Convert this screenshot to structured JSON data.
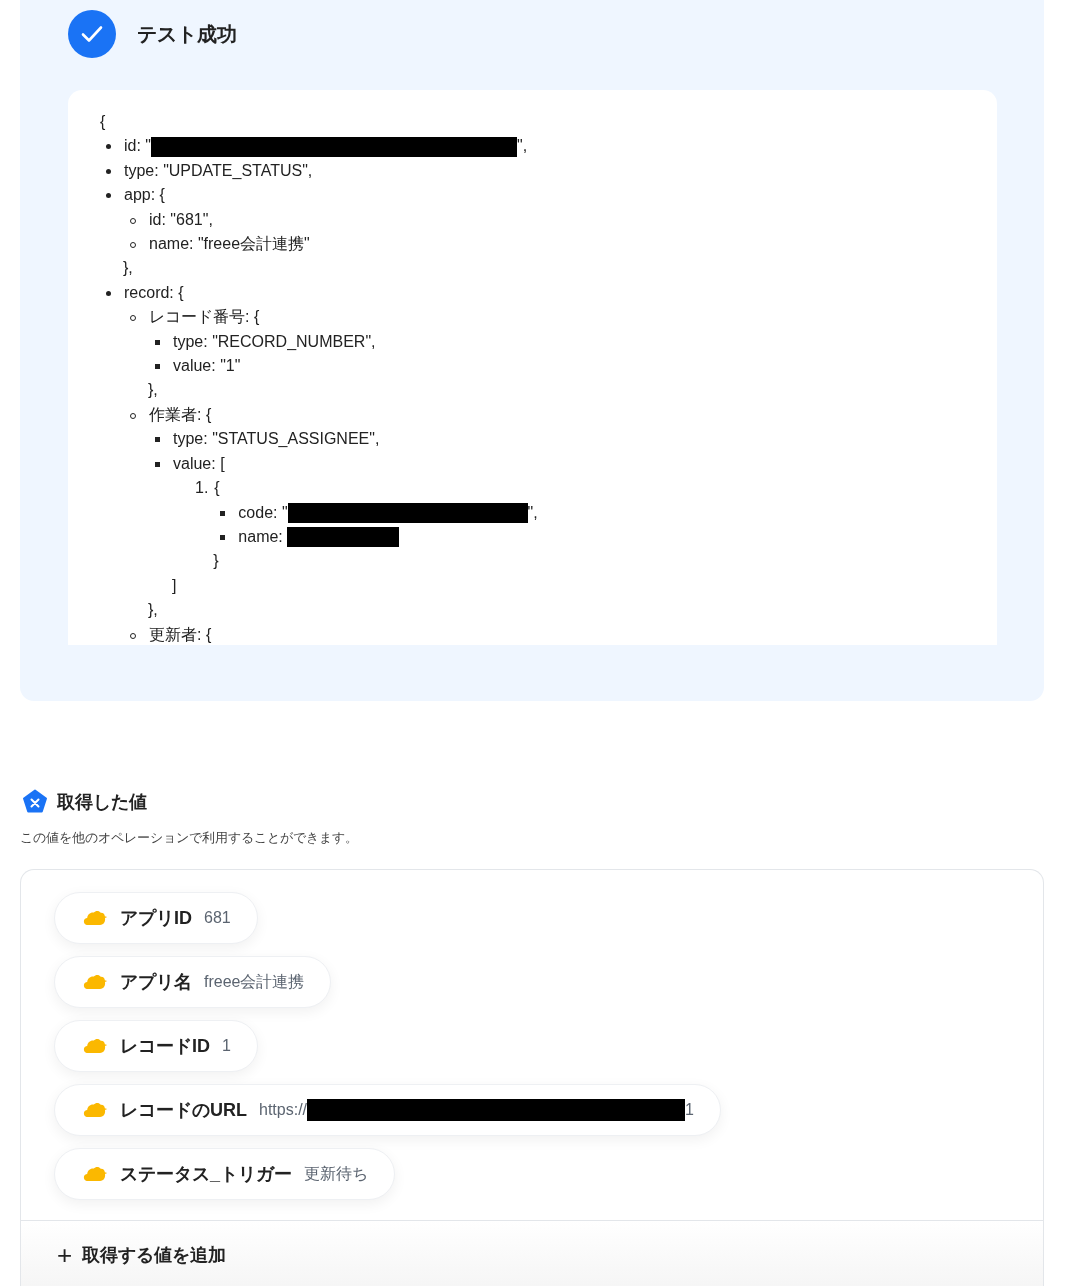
{
  "result": {
    "title": "テスト成功",
    "code": {
      "open": "{",
      "items": [
        {
          "text": "id: \"",
          "redacted": true,
          "after": "\","
        },
        {
          "text": "type: \"UPDATE_STATUS\","
        },
        {
          "text": "app: {",
          "close": "},",
          "children": [
            {
              "text": "id: \"681\","
            },
            {
              "text": "name: \"freee会計連携\""
            }
          ]
        },
        {
          "text": "record: {",
          "children": [
            {
              "text": "レコード番号: {",
              "close": "},",
              "children": [
                {
                  "text": "type: \"RECORD_NUMBER\","
                },
                {
                  "text": "value: \"1\""
                }
              ]
            },
            {
              "text": "作業者: {",
              "close": "},",
              "children": [
                {
                  "text": "type: \"STATUS_ASSIGNEE\","
                },
                {
                  "text": "value: [",
                  "close": "]",
                  "children": [
                    {
                      "number": "1.",
                      "text": "{",
                      "close": "}",
                      "children": [
                        {
                          "text": "code: \"",
                          "redacted": true,
                          "after": "\","
                        },
                        {
                          "text": "name: ",
                          "redacted": true
                        }
                      ]
                    }
                  ]
                }
              ]
            },
            {
              "text": "更新者: {"
            }
          ]
        }
      ]
    }
  },
  "values": {
    "title": "取得した値",
    "description": "この値を他のオペレーションで利用することができます。",
    "items": [
      {
        "label": "アプリID",
        "value": "681"
      },
      {
        "label": "アプリ名",
        "value": "freee会計連携"
      },
      {
        "label": "レコードID",
        "value": "1"
      },
      {
        "label": "レコードのURL",
        "value": "https://",
        "redacted": true,
        "after": "1"
      },
      {
        "label": "ステータス_トリガー",
        "value": "更新待ち"
      }
    ],
    "add_button": {
      "icon": "+",
      "label": "取得する値を追加"
    }
  }
}
